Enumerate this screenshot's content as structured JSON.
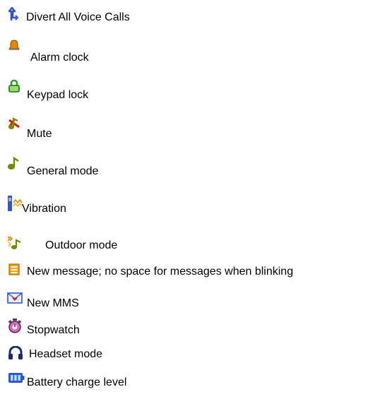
{
  "legend": {
    "items": [
      {
        "icon": "divert-calls-icon",
        "label": "Divert All Voice Calls"
      },
      {
        "icon": "alarm-bell-icon",
        "label": "Alarm clock"
      },
      {
        "icon": "padlock-icon",
        "label": "Keypad lock"
      },
      {
        "icon": "mute-icon",
        "label": "Mute"
      },
      {
        "icon": "music-note-icon",
        "label": "General mode"
      },
      {
        "icon": "vibration-icon",
        "label": "Vibration"
      },
      {
        "icon": "outdoor-mode-icon",
        "label": "Outdoor mode"
      },
      {
        "icon": "message-icon",
        "label": "New message; no space for messages when blinking"
      },
      {
        "icon": "mms-envelope-icon",
        "label": "New MMS"
      },
      {
        "icon": "stopwatch-icon",
        "label": "Stopwatch"
      },
      {
        "icon": "headset-icon",
        "label": "Headset mode"
      },
      {
        "icon": "battery-icon",
        "label": "Battery charge level"
      }
    ]
  },
  "colors": {
    "text": "#000000",
    "background": "#ffffff",
    "icon_blue": "#3355cc",
    "icon_orange": "#e08a00",
    "icon_green": "#2a9d2a",
    "icon_olive": "#7a8a00"
  }
}
